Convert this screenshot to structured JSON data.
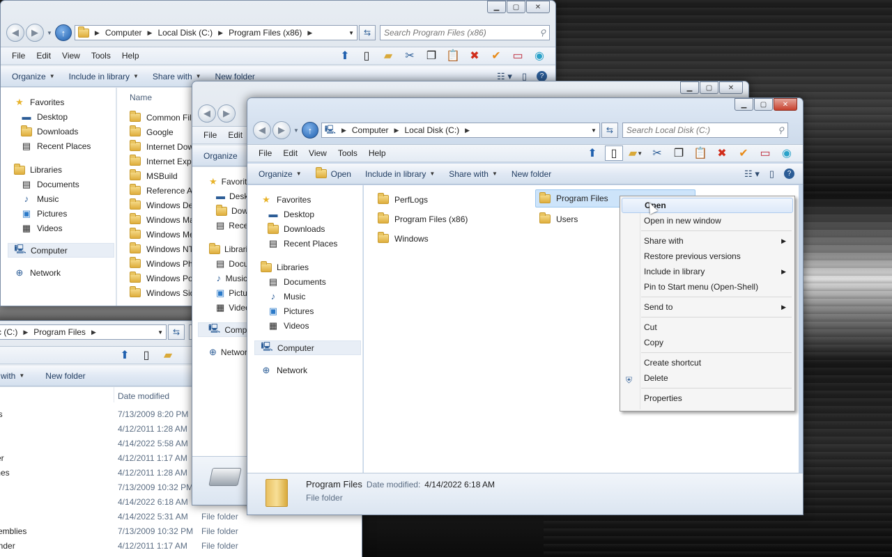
{
  "colors": {
    "accent": "#2b5c96",
    "selection": "#cde4fa",
    "close_red": "#c7402d"
  },
  "back_window": {
    "breadcrumbs": [
      "Computer",
      "Local Disk (C:)",
      "Program Files (x86)"
    ],
    "search_placeholder": "Search Program Files (x86)",
    "menu": [
      "File",
      "Edit",
      "View",
      "Tools",
      "Help"
    ],
    "commands": {
      "organize": "Organize",
      "include": "Include in library",
      "share": "Share with",
      "new_folder": "New folder"
    },
    "nav": {
      "favorites": "Favorites",
      "desktop": "Desktop",
      "downloads": "Downloads",
      "recent": "Recent Places",
      "libraries": "Libraries",
      "documents": "Documents",
      "music": "Music",
      "pictures": "Pictures",
      "videos": "Videos",
      "computer": "Computer",
      "network": "Network"
    },
    "column_name": "Name",
    "items": [
      "Common Files",
      "Google",
      "Internet Download Manager",
      "Internet Explorer",
      "MSBuild",
      "Reference Assemblies",
      "Windows Defender",
      "Windows Mail",
      "Windows Media Player",
      "Windows NT",
      "Windows Photo Viewer",
      "Windows Portable Devices",
      "Windows Sidebar"
    ]
  },
  "left_window": {
    "breadcrumbs": [
      "c (C:)",
      "Program Files"
    ],
    "commands": {
      "share": "e with",
      "new_folder": "New folder"
    },
    "column_date": "Date modified",
    "rows": [
      {
        "name": "es",
        "date": "7/13/2009 8:20 PM",
        "type": ""
      },
      {
        "name": "",
        "date": "4/12/2011 1:28 AM",
        "type": ""
      },
      {
        "name": "",
        "date": "4/14/2022 5:58 AM",
        "type": ""
      },
      {
        "name": "rer",
        "date": "4/12/2011 1:17 AM",
        "type": ""
      },
      {
        "name": "mes",
        "date": "4/12/2011 1:28 AM",
        "type": ""
      },
      {
        "name": "",
        "date": "7/13/2009 10:32 PM",
        "type": ""
      },
      {
        "name": "",
        "date": "4/14/2022 6:18 AM",
        "type": "File folder"
      },
      {
        "name": "",
        "date": "4/14/2022 5:31 AM",
        "type": "File folder"
      },
      {
        "name": "semblies",
        "date": "7/13/2009 10:32 PM",
        "type": "File folder"
      },
      {
        "name": "ender",
        "date": "4/12/2011 1:17 AM",
        "type": "File folder"
      }
    ]
  },
  "middle_window": {
    "menu": [
      "File",
      "Edit"
    ],
    "organize": "Organize",
    "nav": {
      "favorites": "Favorites",
      "desktop": "Desktop",
      "downloads": "Downloads",
      "recent": "Recent Places",
      "libraries": "Libraries",
      "documents": "Documents",
      "music": "Music",
      "pictures": "Pictures",
      "videos": "Videos",
      "computer": "Computer",
      "network": "Network"
    }
  },
  "front_window": {
    "breadcrumbs": [
      "Computer",
      "Local Disk (C:)"
    ],
    "search_placeholder": "Search Local Disk (C:)",
    "menu": [
      "File",
      "Edit",
      "View",
      "Tools",
      "Help"
    ],
    "commands": {
      "organize": "Organize",
      "open": "Open",
      "include": "Include in library",
      "share": "Share with",
      "new_folder": "New folder"
    },
    "nav": {
      "favorites": "Favorites",
      "desktop": "Desktop",
      "downloads": "Downloads",
      "recent": "Recent Places",
      "libraries": "Libraries",
      "documents": "Documents",
      "music": "Music",
      "pictures": "Pictures",
      "videos": "Videos",
      "computer": "Computer",
      "network": "Network"
    },
    "folders": [
      "PerfLogs",
      "Program Files (x86)",
      "Windows",
      "Program Files",
      "Users"
    ],
    "details": {
      "name": "Program Files",
      "date_label": "Date modified:",
      "date": "4/14/2022 6:18 AM",
      "type": "File folder"
    }
  },
  "context_menu": {
    "open": "Open",
    "open_new": "Open in new window",
    "share": "Share with",
    "restore": "Restore previous versions",
    "include": "Include in library",
    "pin": "Pin to Start menu (Open-Shell)",
    "send": "Send to",
    "cut": "Cut",
    "copy": "Copy",
    "shortcut": "Create shortcut",
    "delete": "Delete",
    "properties": "Properties"
  }
}
